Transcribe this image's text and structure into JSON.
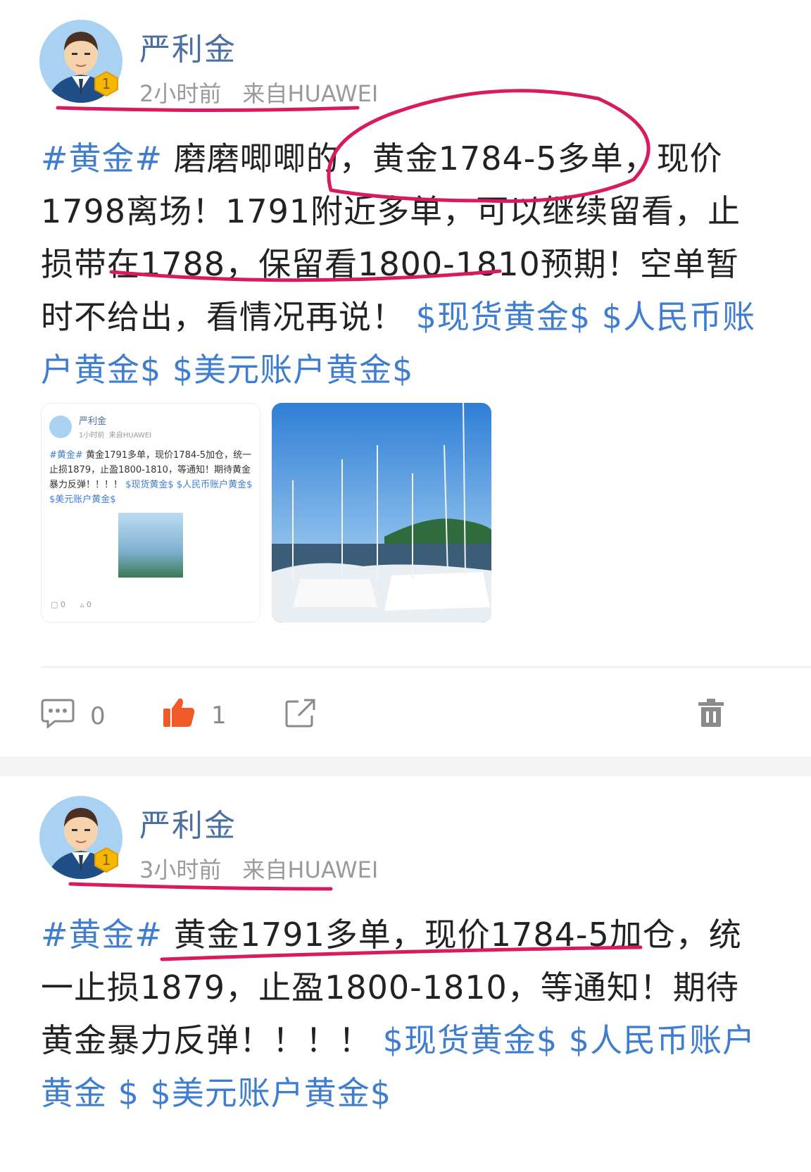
{
  "posts": [
    {
      "author": "严利金",
      "time": "2小时前",
      "source": "来自HUAWEI",
      "hashtag": "#黄金#",
      "text": "磨磨唧唧的，黄金1784-5多单，现价1798离场！1791附近多单，可以继续留看，止损带在1788，保留看1800-1810预期！空单暂时不给出，看情况再说！",
      "links": [
        "$现货黄金$",
        "$人民币账户黄金$",
        "$美元账户黄金$"
      ],
      "badge": "1",
      "attached_screenshot": {
        "author": "严利金",
        "time": "1小时前",
        "source": "来自HUAWEI",
        "hashtag": "#黄金#",
        "text": "黄金1791多单，现价1784-5加仓，统一止损1879，止盈1800-1810，等通知！期待黄金暴力反弹！！！！",
        "links": [
          "$现货黄金$",
          "$人民币账户黄金$",
          "$美元账户黄金$"
        ],
        "comment_count": "0",
        "like_count": "0"
      },
      "actions": {
        "comment_count": "0",
        "like_count": "1"
      }
    },
    {
      "author": "严利金",
      "time": "3小时前",
      "source": "来自HUAWEI",
      "hashtag": "#黄金#",
      "text": "黄金1791多单，现价1784-5加仓，统一止损1879，止盈1800-1810，等通知！期待黄金暴力反弹！！！！",
      "links": [
        "$现货黄金$",
        "$人民币账户黄金",
        "$",
        "$美元账户黄金$"
      ],
      "badge": "1"
    }
  ],
  "colors": {
    "link": "#3f7dd1",
    "name": "#4a6fa0",
    "annotation": "#d81b60",
    "like": "#f05a28"
  },
  "icons": [
    "comment-icon",
    "thumbs-up-icon",
    "share-icon",
    "delete-icon",
    "level-badge-icon"
  ]
}
